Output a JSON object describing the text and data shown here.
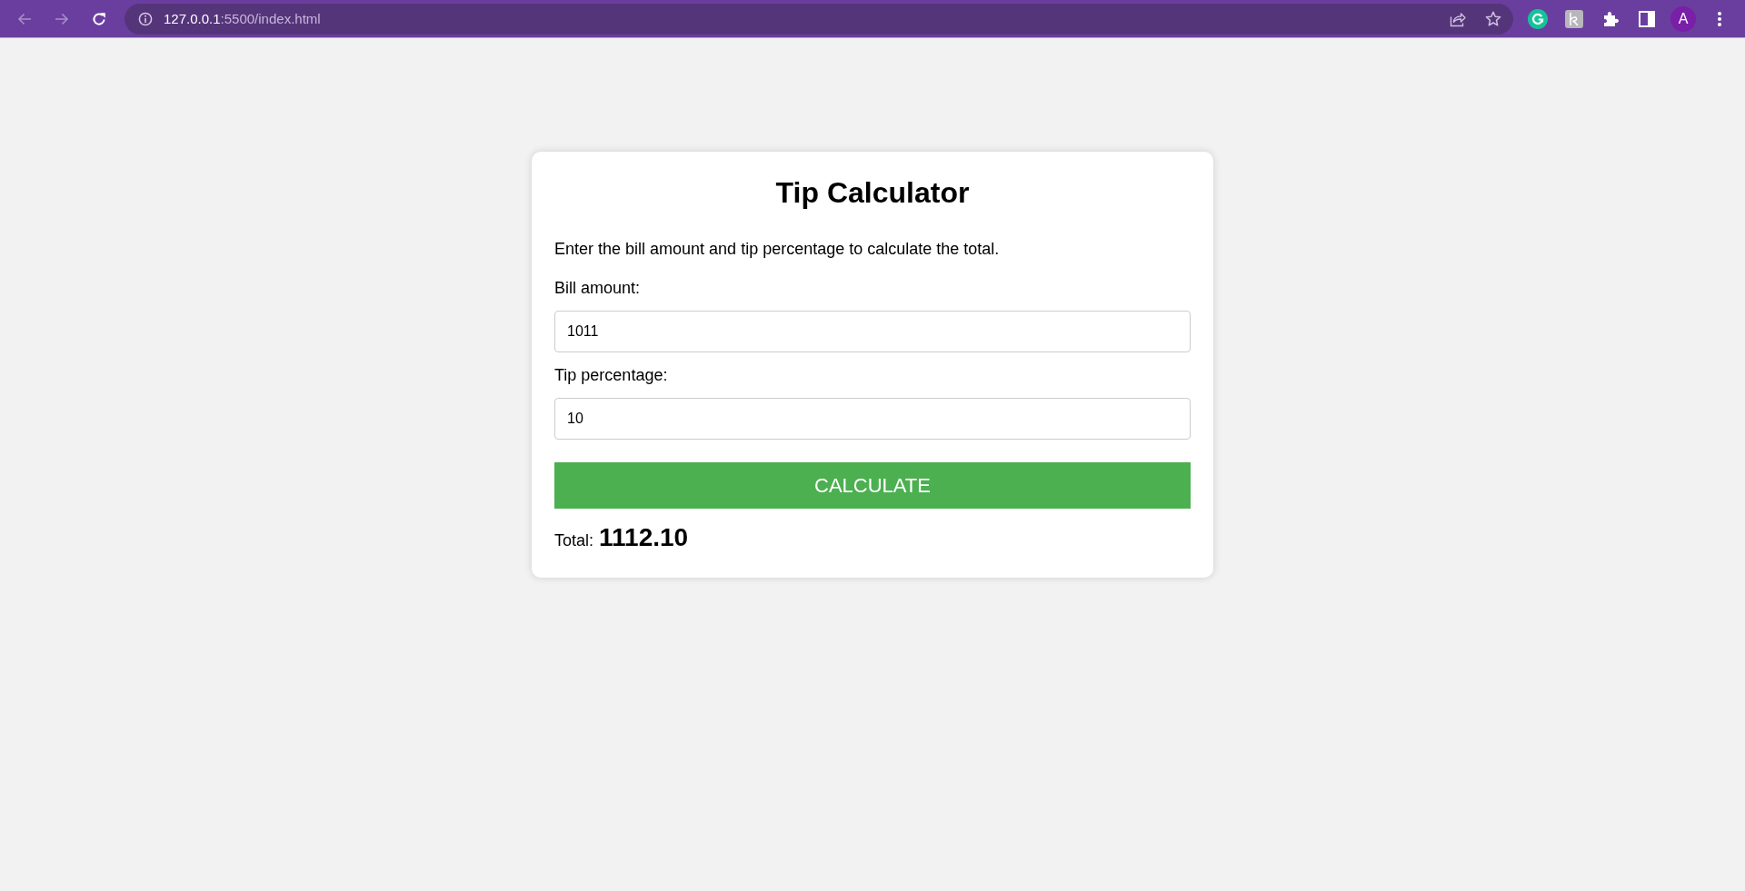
{
  "browser": {
    "back": {
      "disabled": true
    },
    "forward": {
      "disabled": true
    },
    "url_host": "127.0.0.1",
    "url_path": ":5500/index.html",
    "profile_initial": "A"
  },
  "card": {
    "title": "Tip Calculator",
    "description": "Enter the bill amount and tip percentage to calculate the total.",
    "fields": [
      {
        "label": "Bill amount:",
        "value": "1011"
      },
      {
        "label": "Tip percentage:",
        "value": "10"
      }
    ],
    "button": "CALCULATE",
    "total": {
      "label": "Total:",
      "value": "1112.10"
    }
  }
}
